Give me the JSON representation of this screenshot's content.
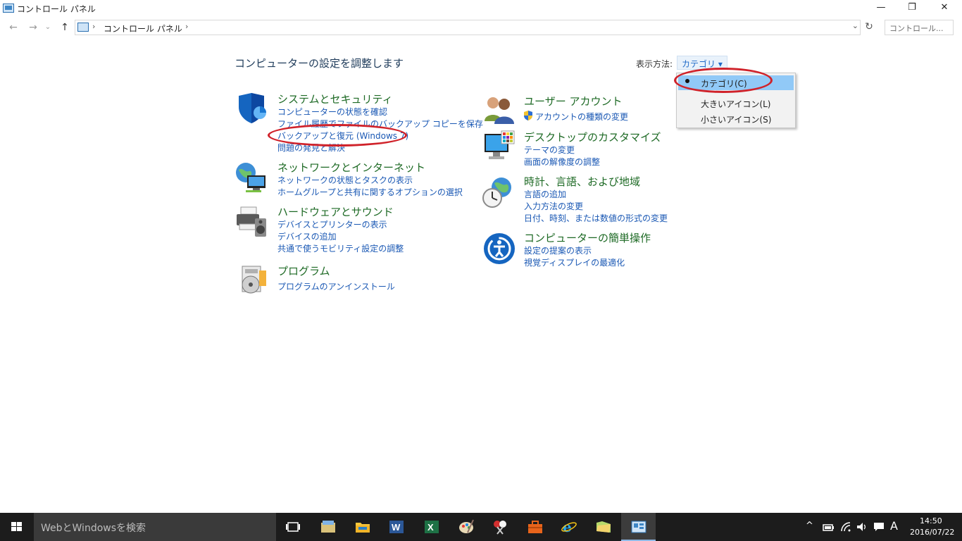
{
  "window": {
    "title": "コントロール パネル",
    "controls": {
      "minimize": "—",
      "restore": "❐",
      "close": "✕"
    }
  },
  "nav": {
    "back": "←",
    "forward": "→",
    "recent": "⌄",
    "up": "↑",
    "breadcrumb_sep": "›",
    "breadcrumb": "コントロール パネル",
    "dropdown": "⌄",
    "refresh": "↻",
    "search_placeholder": "コントロール..."
  },
  "main": {
    "heading": "コンピューターの設定を調整します",
    "view_by_label": "表示方法:",
    "view_by_value": "カテゴリ ▾",
    "left": [
      {
        "title": "システムとセキュリティ",
        "icon": "shield-icon",
        "links": [
          "コンピューターの状態を確認",
          "ファイル履歴でファイルのバックアップ コピーを保存",
          "バックアップと復元 (Windows 7)",
          "問題の発見と解決"
        ]
      },
      {
        "title": "ネットワークとインターネット",
        "icon": "network-globe-icon",
        "links": [
          "ネットワークの状態とタスクの表示",
          "ホームグループと共有に関するオプションの選択"
        ]
      },
      {
        "title": "ハードウェアとサウンド",
        "icon": "printer-speaker-icon",
        "links": [
          "デバイスとプリンターの表示",
          "デバイスの追加",
          "共通で使うモビリティ設定の調整"
        ]
      },
      {
        "title": "プログラム",
        "icon": "program-disc-icon",
        "links": [
          "プログラムのアンインストール"
        ]
      }
    ],
    "right": [
      {
        "title": "ユーザー アカウント",
        "icon": "users-icon",
        "links": [
          "アカウントの種類の変更"
        ]
      },
      {
        "title": "デスクトップのカスタマイズ",
        "icon": "monitor-palette-icon",
        "links": [
          "テーマの変更",
          "画面の解像度の調整"
        ]
      },
      {
        "title": "時計、言語、および地域",
        "icon": "clock-globe-icon",
        "links": [
          "言語の追加",
          "入力方法の変更",
          "日付、時刻、または数値の形式の変更"
        ]
      },
      {
        "title": "コンピューターの簡単操作",
        "icon": "ease-of-access-icon",
        "links": [
          "設定の提案の表示",
          "視覚ディスプレイの最適化"
        ]
      }
    ]
  },
  "view_menu": {
    "items": [
      {
        "label": "カテゴリ(C)",
        "selected": true
      },
      {
        "label": "大きいアイコン(L)",
        "selected": false
      },
      {
        "label": "小さいアイコン(S)",
        "selected": false
      }
    ]
  },
  "taskbar": {
    "search_placeholder": "WebとWindowsを検索",
    "tray": {
      "chevron": "^",
      "ime": "A"
    },
    "time": "14:50",
    "date": "2016/07/22"
  },
  "colors": {
    "category_title": "#1e6a25",
    "link": "#1a58b4",
    "taskbar": "#1c1c1c",
    "menu_highlight": "#91c9f7",
    "annotation": "#d0222a"
  }
}
